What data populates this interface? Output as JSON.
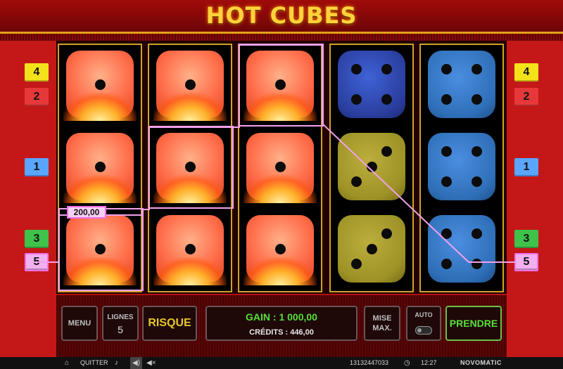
{
  "title": "HOT CUBES",
  "left_lines": [
    {
      "label": "4",
      "color": "#f3e21a"
    },
    {
      "label": "2",
      "color": "#e6383a"
    },
    {
      "label": "1",
      "color": "#5aa6ff"
    },
    {
      "label": "3",
      "color": "#3fc24a"
    },
    {
      "label": "5",
      "color": "#f1b0ef"
    }
  ],
  "right_lines": [
    {
      "label": "4",
      "color": "#f3e21a"
    },
    {
      "label": "2",
      "color": "#e6383a"
    },
    {
      "label": "1",
      "color": "#5aa6ff"
    },
    {
      "label": "3",
      "color": "#3fc24a"
    },
    {
      "label": "5",
      "color": "#f1b0ef"
    }
  ],
  "reels": [
    [
      {
        "face": 1,
        "color": "hot"
      },
      {
        "face": 1,
        "color": "hot"
      },
      {
        "face": 1,
        "color": "hot"
      }
    ],
    [
      {
        "face": 1,
        "color": "hot"
      },
      {
        "face": 1,
        "color": "hot"
      },
      {
        "face": 1,
        "color": "hot"
      }
    ],
    [
      {
        "face": 1,
        "color": "hot"
      },
      {
        "face": 1,
        "color": "hot"
      },
      {
        "face": 1,
        "color": "hot"
      }
    ],
    [
      {
        "face": 4,
        "color": "blue"
      },
      {
        "face": 3,
        "color": "olive"
      },
      {
        "face": 3,
        "color": "olive"
      }
    ],
    [
      {
        "face": 4,
        "color": "steel"
      },
      {
        "face": 4,
        "color": "steel"
      },
      {
        "face": 4,
        "color": "steel"
      }
    ]
  ],
  "win_amount": "200,00",
  "controls": {
    "menu": "MENU",
    "lines_label": "LIGNES",
    "lines_value": "5",
    "risk": "RISQUE",
    "gain": "GAIN : 1 000,00",
    "credits": "CRÉDITS : 446,00",
    "max_bet_line1": "MISE",
    "max_bet_line2": "MAX.",
    "auto": "AUTO",
    "take": "PRENDRE"
  },
  "status": {
    "quit": "QUITTER",
    "session_id": "13132447033",
    "time": "12:27",
    "brand": "NOVOMATIC"
  }
}
